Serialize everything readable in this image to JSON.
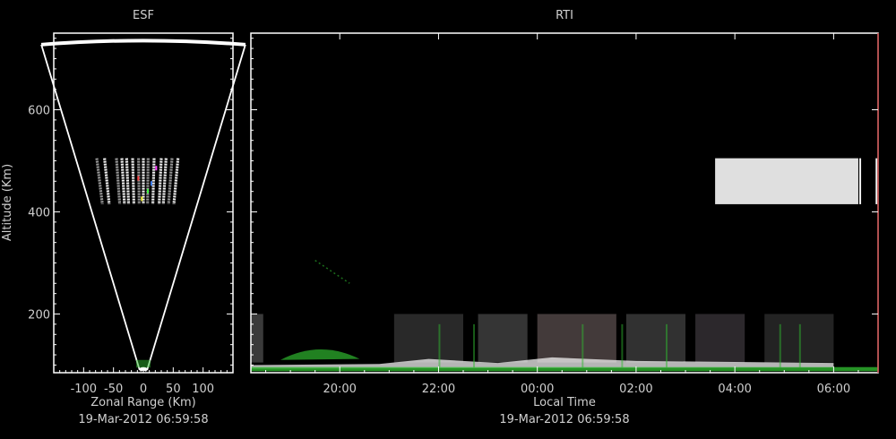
{
  "colors": {
    "background": "#000000",
    "axes": "#ffffff",
    "text": "#cfcfcf",
    "echo_green": "#2fb82f",
    "echo_white": "#f2f2f2",
    "echo_gray": "#9a9a9a",
    "rti_right_edge": "#c04040"
  },
  "chart_data": [
    {
      "type": "heatmap",
      "title": "ESF",
      "xlabel": "Zonal Range (Km)",
      "ylabel": "Altitude (Km)",
      "footer": "19-Mar-2012 06:59:58",
      "xlim": [
        -150,
        150
      ],
      "ylim": [
        85,
        750
      ],
      "xticks": [
        -100,
        -50,
        0,
        50,
        100
      ],
      "xtick_labels": [
        "-100",
        "-50",
        "0",
        "50",
        "100"
      ],
      "yticks": [
        200,
        400,
        600
      ],
      "ytick_labels": [
        "200",
        "400",
        "600"
      ],
      "fan": {
        "apex_altitude": 90,
        "edge_angle_deg": 15,
        "outer_range": 750
      },
      "echo_bands": {
        "altitude_low": 415,
        "altitude_high": 505,
        "zonal_positions": [
          -78,
          -65,
          -45,
          -36,
          -28,
          -18,
          -8,
          0,
          8,
          18,
          30,
          38,
          48,
          58
        ]
      },
      "low_echo": {
        "altitude": 95,
        "zonal_center": 0
      }
    },
    {
      "type": "heatmap",
      "title": "RTI",
      "xlabel": "Local Time",
      "ylabel": "",
      "footer": "19-Mar-2012 06:59:58",
      "x_hours_since_midnight": [
        -5.8,
        6.9
      ],
      "xticks_hours": [
        -4,
        -2,
        0,
        2,
        4,
        6
      ],
      "xtick_labels": [
        "20:00",
        "22:00",
        "00:00",
        "02:00",
        "04:00",
        "06:00"
      ],
      "ylim": [
        85,
        750
      ],
      "yticks": [
        200,
        400,
        600
      ],
      "bright_block": {
        "start_hour": 3.6,
        "end_hour": 6.5,
        "altitude_low": 415,
        "altitude_high": 505
      },
      "late_slivers_hours": [
        6.52,
        6.85
      ],
      "low_echo_layer": {
        "altitude_low": 88,
        "altitude_high": 200,
        "start_hour": -5.8,
        "end_hour": 6.9
      },
      "faint_trace": {
        "start_hour": -4.5,
        "end_hour": -3.8,
        "altitude_start": 305,
        "altitude_end": 260
      }
    }
  ]
}
